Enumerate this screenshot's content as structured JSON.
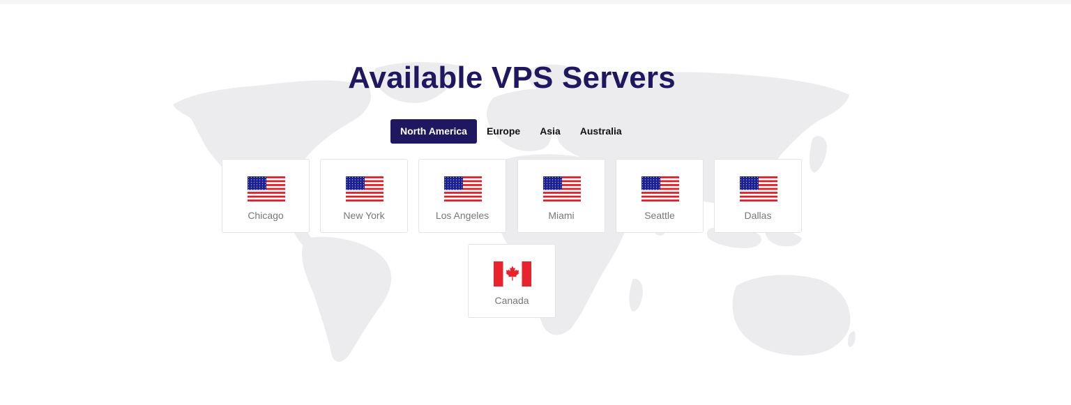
{
  "page": {
    "title": "Available VPS Servers"
  },
  "tabs": [
    {
      "label": "North America",
      "active": true
    },
    {
      "label": "Europe",
      "active": false
    },
    {
      "label": "Asia",
      "active": false
    },
    {
      "label": "Australia",
      "active": false
    }
  ],
  "locations": [
    {
      "city": "Chicago",
      "flag": "us-flag"
    },
    {
      "city": "New York",
      "flag": "us-flag"
    },
    {
      "city": "Los Angeles",
      "flag": "us-flag"
    },
    {
      "city": "Miami",
      "flag": "us-flag"
    },
    {
      "city": "Seattle",
      "flag": "us-flag"
    },
    {
      "city": "Dallas",
      "flag": "us-flag"
    },
    {
      "city": "Canada",
      "flag": "canada-flag"
    }
  ],
  "colors": {
    "brand": "#1f1760",
    "map": "#ececee",
    "us_red": "#e31b23",
    "us_blue": "#1c2295",
    "ca_red": "#e8232e"
  }
}
